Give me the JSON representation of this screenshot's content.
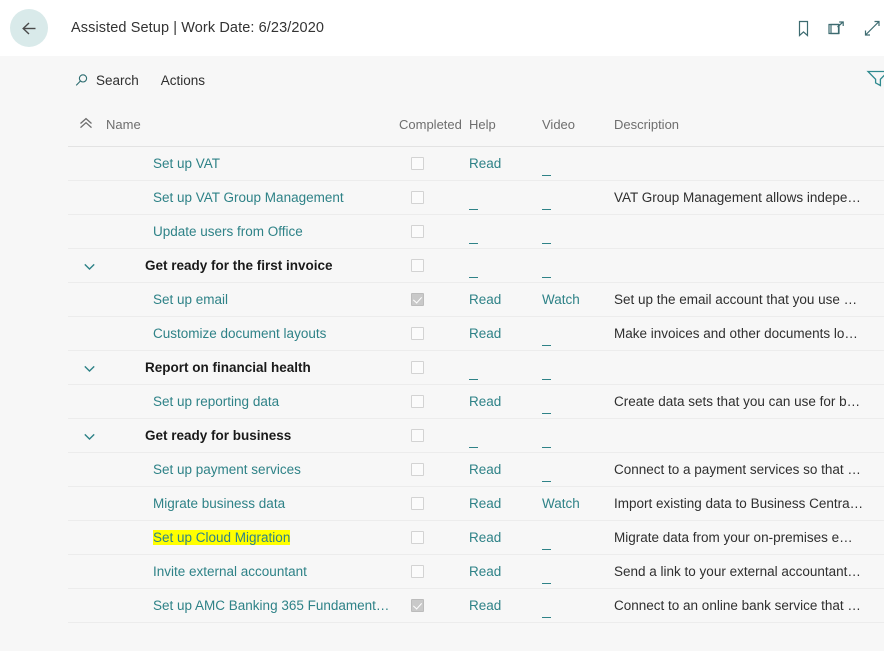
{
  "titlebar": {
    "title": "Assisted Setup | Work Date: 6/23/2020",
    "back_icon": "arrow-left-icon",
    "icons": [
      {
        "name": "bookmark-icon"
      },
      {
        "name": "open-in-new-window-icon"
      },
      {
        "name": "expand-diagonal-icon"
      }
    ]
  },
  "commandbar": {
    "search_label": "Search",
    "search_icon": "search-icon",
    "actions_label": "Actions",
    "filter_icon": "filter-icon"
  },
  "grid": {
    "collapse_all_icon": "chevron-double-up-icon",
    "columns": {
      "name": "Name",
      "completed": "Completed",
      "help": "Help",
      "video": "Video",
      "description": "Description"
    },
    "rows": [
      {
        "type": "item",
        "name": "Set up VAT",
        "completed": false,
        "help": "Read",
        "video": "_",
        "description": "",
        "highlighted": false
      },
      {
        "type": "item",
        "name": "Set up VAT Group Management",
        "completed": false,
        "help": "_",
        "video": "_",
        "description": "VAT Group Management allows indepe…",
        "highlighted": false
      },
      {
        "type": "item",
        "name": "Update users from Office",
        "completed": false,
        "help": "_",
        "video": "_",
        "description": "",
        "highlighted": false
      },
      {
        "type": "group",
        "name": "Get ready for the first invoice",
        "completed": false,
        "help": "_",
        "video": "_",
        "description": "",
        "highlighted": false
      },
      {
        "type": "item",
        "name": "Set up email",
        "completed": true,
        "help": "Read",
        "video": "Watch",
        "description": "Set up the email account that you use …",
        "highlighted": false
      },
      {
        "type": "item",
        "name": "Customize document layouts",
        "completed": false,
        "help": "Read",
        "video": "_",
        "description": "Make invoices and other documents lo…",
        "highlighted": false
      },
      {
        "type": "group",
        "name": "Report on financial health",
        "completed": false,
        "help": "_",
        "video": "_",
        "description": "",
        "highlighted": false
      },
      {
        "type": "item",
        "name": "Set up reporting data",
        "completed": false,
        "help": "Read",
        "video": "_",
        "description": "Create data sets that you can use for b…",
        "highlighted": false
      },
      {
        "type": "group",
        "name": "Get ready for business",
        "completed": false,
        "help": "_",
        "video": "_",
        "description": "",
        "highlighted": false
      },
      {
        "type": "item",
        "name": "Set up payment services",
        "completed": false,
        "help": "Read",
        "video": "_",
        "description": "Connect to a payment services so that …",
        "highlighted": false
      },
      {
        "type": "item",
        "name": "Migrate business data",
        "completed": false,
        "help": "Read",
        "video": "Watch",
        "description": "Import existing data to Business Centra…",
        "highlighted": false
      },
      {
        "type": "item",
        "name": "Set up Cloud Migration",
        "completed": false,
        "help": "Read",
        "video": "_",
        "description": "Migrate data from your on-premises e…",
        "highlighted": true
      },
      {
        "type": "item",
        "name": "Invite external accountant",
        "completed": false,
        "help": "Read",
        "video": "_",
        "description": "Send a link to your external accountant…",
        "highlighted": false
      },
      {
        "type": "item",
        "name": "Set up AMC Banking 365 Fundament…",
        "completed": true,
        "help": "Read",
        "video": "_",
        "description": "Connect to an online bank service that …",
        "highlighted": false
      }
    ]
  },
  "colors": {
    "link": "#2e8287",
    "accent_back_button": "#d9eaea",
    "highlight": "#ffff00",
    "page_background": "#f7f7f7"
  }
}
